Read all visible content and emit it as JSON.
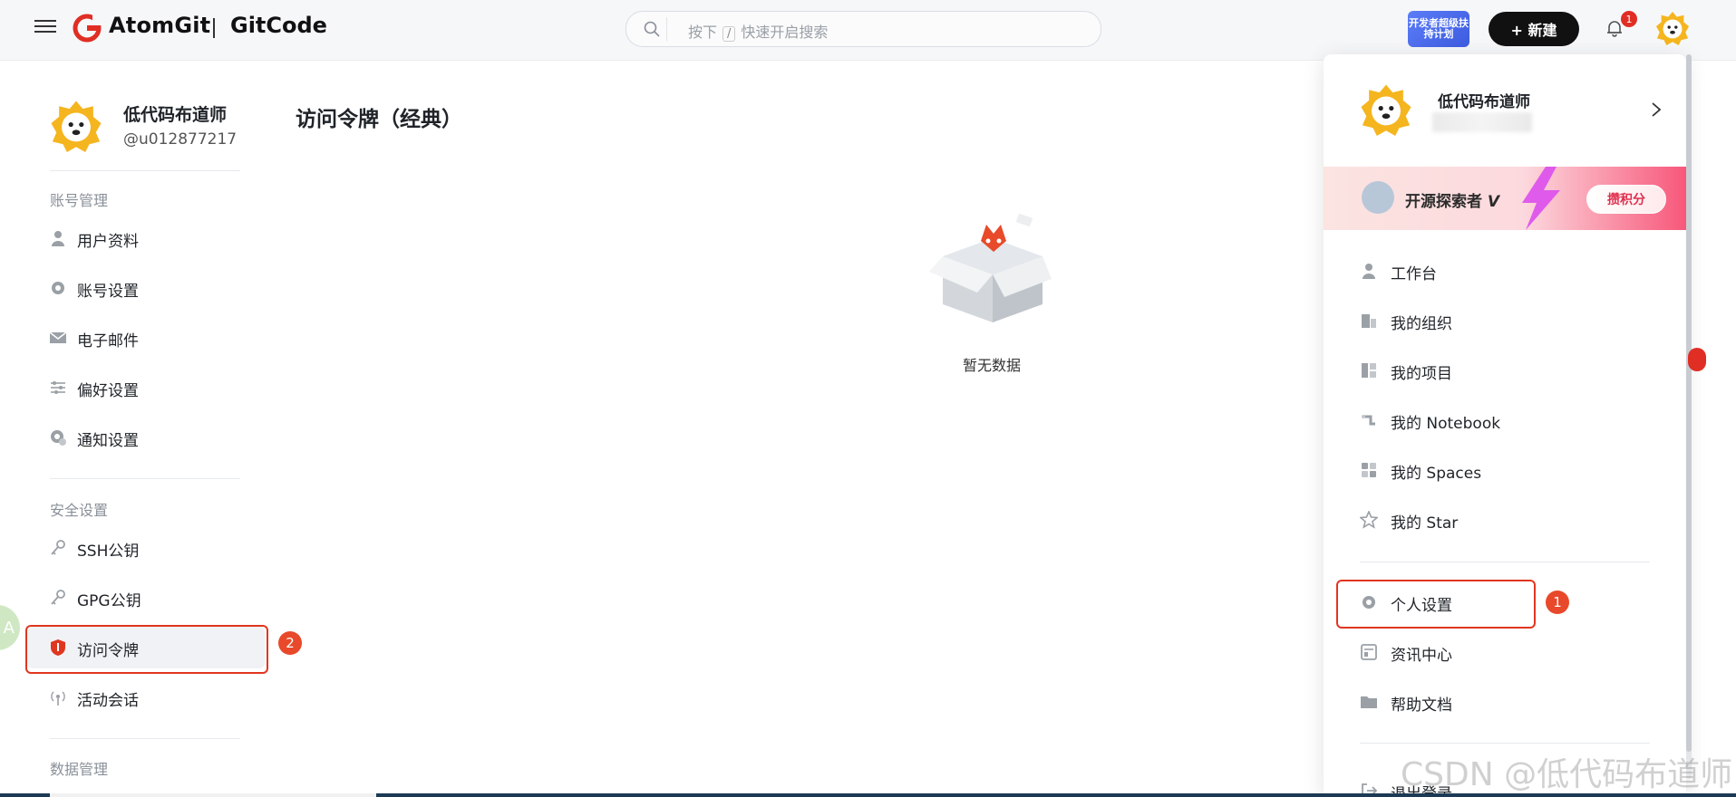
{
  "header": {
    "logo_text": "AtomGit",
    "logo_text2": "GitCode",
    "search_placeholder_pre": "按下",
    "search_key": "/",
    "search_placeholder_post": "快速开启搜索",
    "promo_badge": "开发者超级扶持计划",
    "new_button": "+ 新建",
    "notification_count": "1"
  },
  "profile": {
    "name": "低代码布道师",
    "handle": "@u012877217"
  },
  "sidebar": {
    "sections": [
      {
        "title": "账号管理",
        "items": [
          {
            "label": "用户资料",
            "icon": "user-icon"
          },
          {
            "label": "账号设置",
            "icon": "gear-icon"
          },
          {
            "label": "电子邮件",
            "icon": "mail-icon"
          },
          {
            "label": "偏好设置",
            "icon": "sliders-icon"
          },
          {
            "label": "通知设置",
            "icon": "bell-gear-icon"
          }
        ]
      },
      {
        "title": "安全设置",
        "items": [
          {
            "label": "SSH公钥",
            "icon": "key-icon"
          },
          {
            "label": "GPG公钥",
            "icon": "key-icon"
          },
          {
            "label": "访问令牌",
            "icon": "shield-icon"
          },
          {
            "label": "活动会话",
            "icon": "broadcast-icon"
          }
        ]
      },
      {
        "title": "数据管理",
        "items": []
      }
    ]
  },
  "steps": {
    "step1": "1",
    "step2": "2"
  },
  "main": {
    "title": "访问令牌（经典）",
    "empty_text": "暂无数据"
  },
  "dropdown": {
    "name": "低代码布道师",
    "banner_text": "开源探索者",
    "banner_level": "V",
    "banner_button": "攒积分",
    "items": [
      {
        "label": "工作台",
        "icon": "user-icon"
      },
      {
        "label": "我的组织",
        "icon": "building-icon"
      },
      {
        "label": "我的项目",
        "icon": "project-icon"
      },
      {
        "label": "我的 Notebook",
        "icon": "notebook-icon"
      },
      {
        "label": "我的 Spaces",
        "icon": "grid-icon"
      },
      {
        "label": "我的 Star",
        "icon": "star-icon"
      }
    ],
    "items2": [
      {
        "label": "个人设置",
        "icon": "gear-icon"
      },
      {
        "label": "资讯中心",
        "icon": "news-icon"
      },
      {
        "label": "帮助文档",
        "icon": "folder-icon"
      },
      {
        "label": "退出登录",
        "icon": "logout-icon"
      }
    ]
  },
  "watermark": "CSDN @低代码布道师",
  "colors": {
    "accent_red": "#e0361f",
    "brand_red": "#e02e24"
  }
}
